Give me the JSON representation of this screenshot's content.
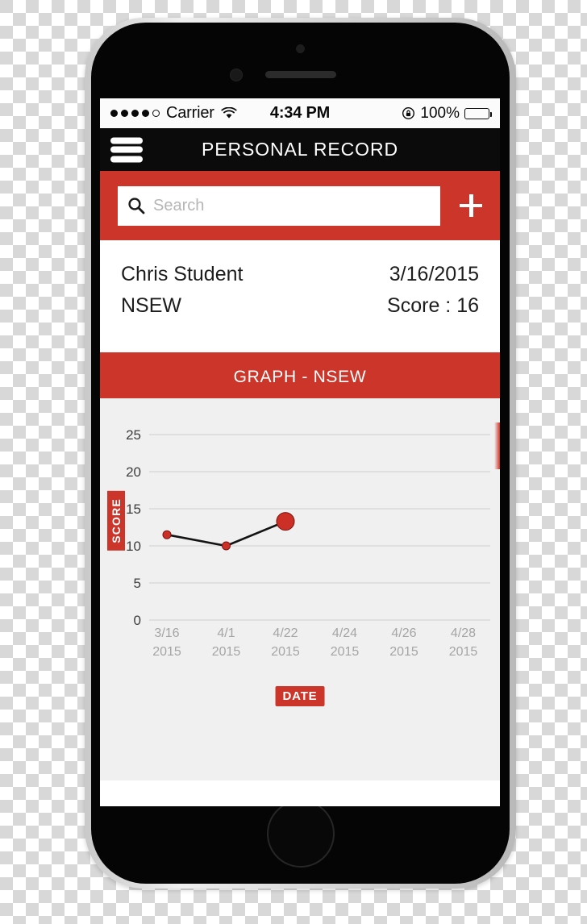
{
  "status_bar": {
    "signal_dots_filled": 4,
    "signal_dots_total": 5,
    "carrier": "Carrier",
    "wifi_icon": "wifi-icon",
    "time": "4:34 PM",
    "lock_icon": "rotation-lock-icon",
    "battery_percent": "100%",
    "battery_icon": "battery-full-icon"
  },
  "nav_bar": {
    "menu_icon": "hamburger-menu-icon",
    "title": "PERSONAL RECORD"
  },
  "search": {
    "icon": "search-icon",
    "placeholder": "Search",
    "value": "",
    "add_icon": "plus-icon"
  },
  "record": {
    "name": "Chris Student",
    "date": "3/16/2015",
    "category": "NSEW",
    "score": "Score : 16"
  },
  "graph_header": {
    "title": "GRAPH - NSEW"
  },
  "chart_data": {
    "type": "line",
    "title": "GRAPH - NSEW",
    "xlabel": "DATE",
    "ylabel": "SCORE",
    "x_tick_labels": [
      [
        "3/16",
        "2015"
      ],
      [
        "4/1",
        "2015"
      ],
      [
        "4/22",
        "2015"
      ],
      [
        "4/24",
        "2015"
      ],
      [
        "4/26",
        "2015"
      ],
      [
        "4/28",
        "2015"
      ]
    ],
    "categories": [
      "3/16/2015",
      "4/1/2015",
      "4/22/2015",
      "4/24/2015",
      "4/26/2015",
      "4/28/2015"
    ],
    "y_ticks": [
      0,
      5,
      10,
      15,
      20,
      25
    ],
    "ylim": [
      0,
      27
    ],
    "grid": true,
    "legend": "none",
    "series": [
      {
        "name": "NSEW",
        "point_color": "#cc2f26",
        "line_color": "#131313",
        "values": [
          11.5,
          10.0,
          13.3,
          null,
          null,
          null
        ],
        "point_radius": [
          5,
          5,
          11
        ]
      }
    ]
  },
  "colors": {
    "brand_red": "#cc352a",
    "nav_black": "#0b0b0b",
    "graph_bg": "#f0f0f0",
    "gridline": "#d9d9d9",
    "point_red": "#cc2f26"
  }
}
